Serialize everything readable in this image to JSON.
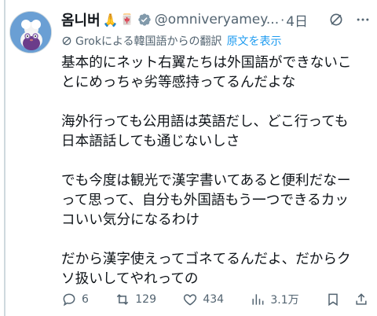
{
  "author": {
    "display_name": "옴니버",
    "emoji": "🙏",
    "badge_emoji": "🀄",
    "handle": "@omniveryamey...",
    "separator": "·",
    "time": "4日"
  },
  "translation": {
    "label": "Grokによる韓国語からの翻訳",
    "show_original": "原文を表示"
  },
  "post": {
    "paragraphs": [
      [
        "基本的にネット右翼たちは外国語ができないこ",
        "とにめっちゃ劣等感持ってるんだよな"
      ],
      [
        "海外行っても公用語は英語だし、どこ行っても",
        "日本語話しても通じないしさ"
      ],
      [
        "でも今度は観光で漢字書いてあると便利だなー",
        "って思って、自分も外国語もう一つできるカッ",
        "コいい気分になるわけ"
      ],
      [
        "だから漢字使えってゴネてるんだよ、だからク",
        "ソ扱いしてやれっての"
      ]
    ]
  },
  "actions": {
    "replies": "6",
    "reposts": "129",
    "likes": "434",
    "views": "3.1万"
  },
  "colors": {
    "accent": "#1d9bf0",
    "muted": "#536471",
    "text": "#0f1419"
  }
}
